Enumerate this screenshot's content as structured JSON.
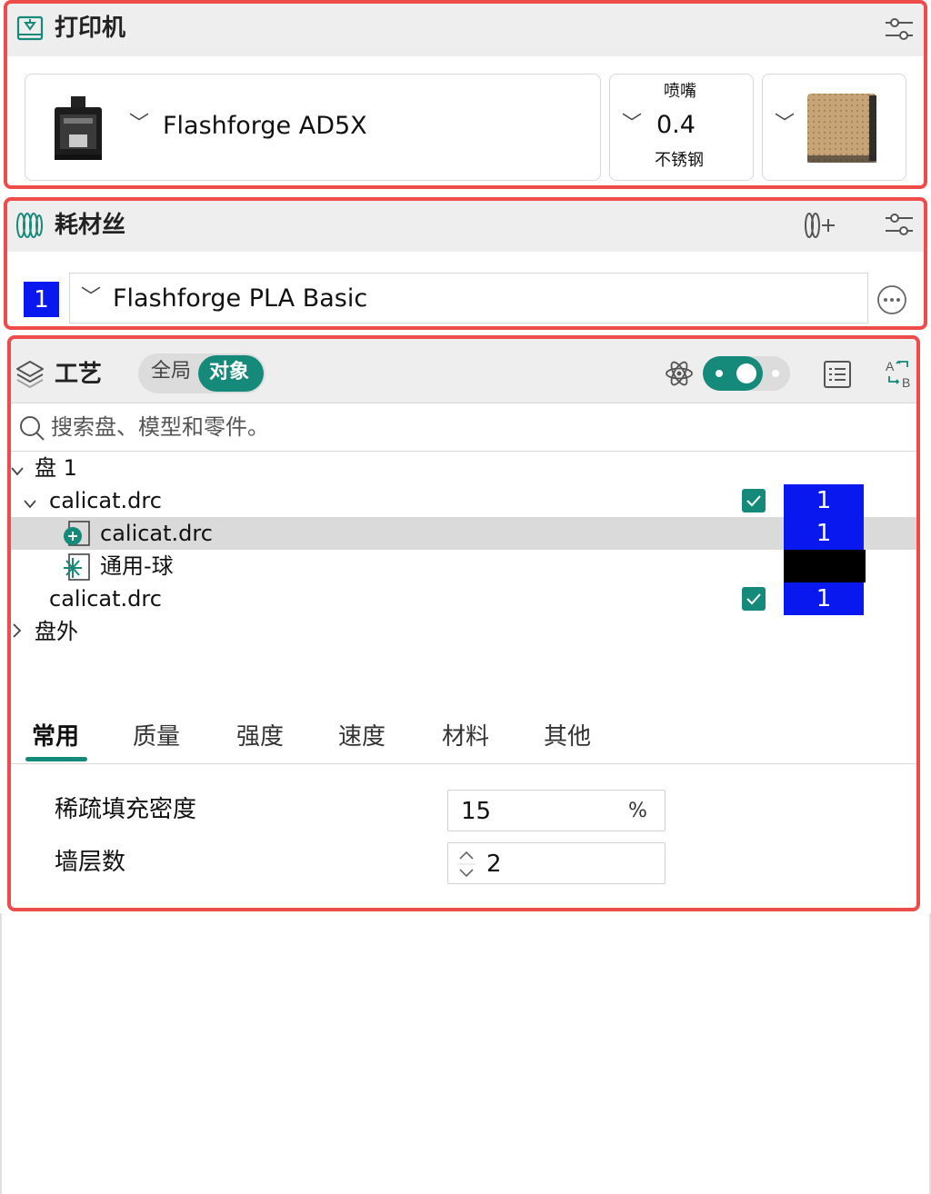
{
  "printer": {
    "title": "打印机",
    "name": "Flashforge AD5X",
    "nozzle_label": "喷嘴",
    "nozzle_size": "0.4",
    "nozzle_material": "不锈钢"
  },
  "filament": {
    "title": "耗材丝",
    "index": "1",
    "name": "Flashforge PLA Basic",
    "index_color": "#0a18f0"
  },
  "process": {
    "title": "工艺",
    "toggle_global": "全局",
    "toggle_object": "对象",
    "search_placeholder": "搜索盘、模型和零件。",
    "accent_color": "#15897a"
  },
  "tree": {
    "plate": "盘 1",
    "object1": {
      "name": "calicat.drc",
      "filament": "1",
      "checked": true
    },
    "part": {
      "name": "calicat.drc",
      "filament": "1"
    },
    "modifier": {
      "name": "通用-球"
    },
    "object2": {
      "name": "calicat.drc",
      "filament": "1",
      "checked": true
    },
    "outside": "盘外"
  },
  "tabs": [
    "常用",
    "质量",
    "强度",
    "速度",
    "材料",
    "其他"
  ],
  "active_tab": 0,
  "params": {
    "infill_label": "稀疏填充密度",
    "infill_value": "15",
    "infill_unit": "%",
    "walls_label": "墙层数",
    "walls_value": "2"
  }
}
